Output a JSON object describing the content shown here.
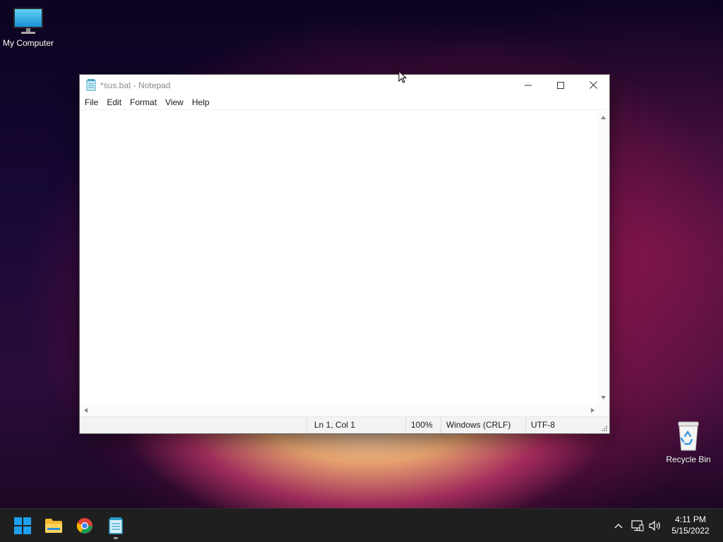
{
  "desktop": {
    "icons": [
      {
        "label": "My Computer",
        "icon": "monitor-icon"
      },
      {
        "label": "Recycle Bin",
        "icon": "recycle-bin-icon"
      }
    ]
  },
  "window": {
    "title": "*sus.bat - Notepad",
    "app_icon": "notepad-icon",
    "controls": {
      "minimize": "minimize-icon",
      "maximize": "maximize-icon",
      "close": "close-icon"
    },
    "menu": [
      "File",
      "Edit",
      "Format",
      "View",
      "Help"
    ],
    "content": "",
    "status": {
      "position": "Ln 1, Col 1",
      "zoom": "100%",
      "line_ending": "Windows (CRLF)",
      "encoding": "UTF-8"
    }
  },
  "taskbar": {
    "apps": [
      {
        "name": "Start",
        "icon": "windows-start-icon"
      },
      {
        "name": "File Explorer",
        "icon": "folder-icon"
      },
      {
        "name": "Google Chrome",
        "icon": "chrome-icon"
      },
      {
        "name": "Notepad",
        "icon": "notepad-icon",
        "running": true
      }
    ],
    "tray": {
      "icons": [
        "chevron-up-icon",
        "network-icon",
        "volume-icon"
      ],
      "time": "4:11 PM",
      "date": "5/15/2022"
    }
  },
  "colors": {
    "taskbar_bg": "#1f1f1f",
    "accent_blue": "#0078d4",
    "wallpaper_glow": "#f0285a"
  }
}
